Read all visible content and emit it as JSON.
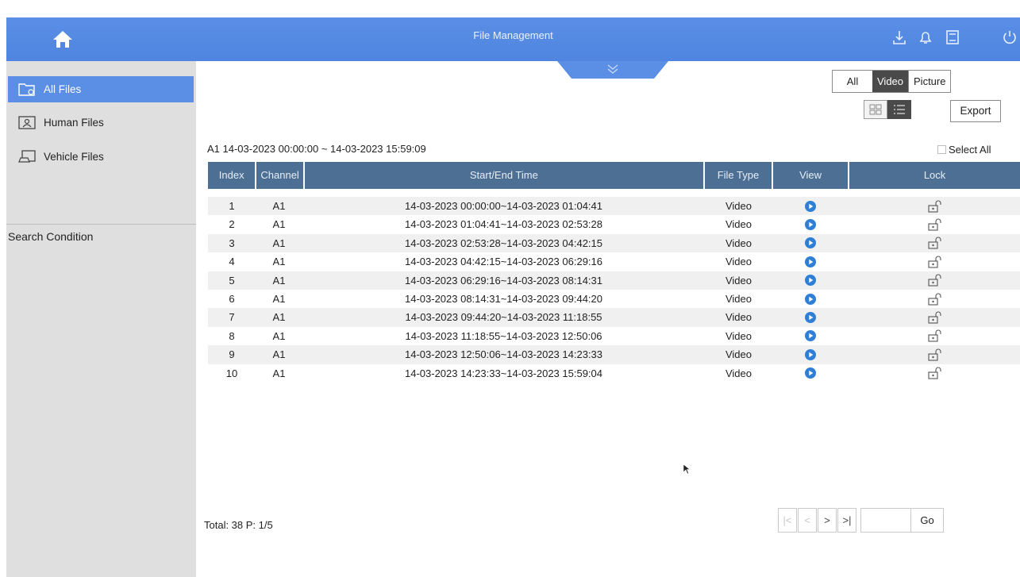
{
  "header": {
    "title": "File Management"
  },
  "sidebar": {
    "items": [
      {
        "label": "All Files",
        "active": true
      },
      {
        "label": "Human Files",
        "active": false
      },
      {
        "label": "Vehicle Files",
        "active": false
      }
    ],
    "search_condition": "Search Condition"
  },
  "filters": {
    "all": "All",
    "video": "Video",
    "picture": "Picture",
    "selected": "Video"
  },
  "toolbar": {
    "export_label": "Export",
    "view_mode": "list"
  },
  "range_text": "A1 14-03-2023 00:00:00 ~ 14-03-2023 15:59:09",
  "select_all_label": "Select All",
  "table": {
    "headers": [
      "Index",
      "Channel",
      "Start/End Time",
      "File Type",
      "View",
      "Lock"
    ],
    "rows": [
      {
        "index": "1",
        "channel": "A1",
        "time": "14-03-2023 00:00:00~14-03-2023 01:04:41",
        "type": "Video"
      },
      {
        "index": "2",
        "channel": "A1",
        "time": "14-03-2023 01:04:41~14-03-2023 02:53:28",
        "type": "Video"
      },
      {
        "index": "3",
        "channel": "A1",
        "time": "14-03-2023 02:53:28~14-03-2023 04:42:15",
        "type": "Video"
      },
      {
        "index": "4",
        "channel": "A1",
        "time": "14-03-2023 04:42:15~14-03-2023 06:29:16",
        "type": "Video"
      },
      {
        "index": "5",
        "channel": "A1",
        "time": "14-03-2023 06:29:16~14-03-2023 08:14:31",
        "type": "Video"
      },
      {
        "index": "6",
        "channel": "A1",
        "time": "14-03-2023 08:14:31~14-03-2023 09:44:20",
        "type": "Video"
      },
      {
        "index": "7",
        "channel": "A1",
        "time": "14-03-2023 09:44:20~14-03-2023 11:18:55",
        "type": "Video"
      },
      {
        "index": "8",
        "channel": "A1",
        "time": "14-03-2023 11:18:55~14-03-2023 12:50:06",
        "type": "Video"
      },
      {
        "index": "9",
        "channel": "A1",
        "time": "14-03-2023 12:50:06~14-03-2023 14:23:33",
        "type": "Video"
      },
      {
        "index": "10",
        "channel": "A1",
        "time": "14-03-2023 14:23:33~14-03-2023 15:59:04",
        "type": "Video"
      }
    ]
  },
  "footer": {
    "total_text": "Total: 38  P: 1/5",
    "go_label": "Go"
  },
  "colors": {
    "accent": "#5b8fe6",
    "table_header": "#4d6f94",
    "play_icon": "#2f7fd6",
    "sidebar": "#dfdfdf"
  }
}
